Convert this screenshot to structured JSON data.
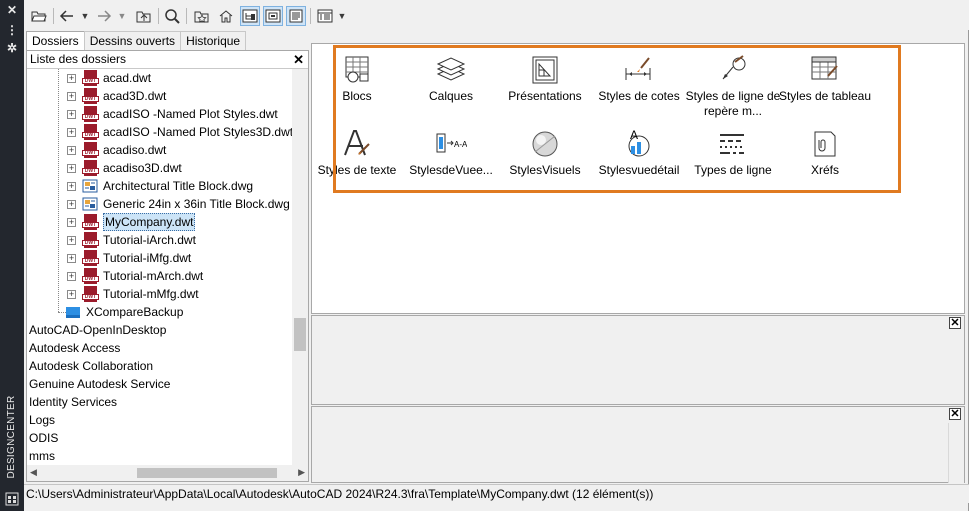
{
  "palette": {
    "title": "DESIGNCENTER",
    "close_glyph": "✕",
    "grip_glyph": "⋮",
    "settings_glyph": "✲"
  },
  "toolbar": {
    "buttons": [
      {
        "name": "open-folder-button",
        "icon": "folder-open-icon"
      },
      {
        "name": "back-button",
        "icon": "back-arrow-icon"
      },
      {
        "name": "back-menu-button",
        "icon": "chevron-down-icon"
      },
      {
        "name": "forward-button",
        "icon": "forward-arrow-icon"
      },
      {
        "name": "forward-menu-button",
        "icon": "chevron-down-icon"
      },
      {
        "name": "up-button",
        "icon": "up-folder-icon"
      },
      {
        "name": "search-button",
        "icon": "search-icon"
      },
      {
        "name": "favorites-button",
        "icon": "star-folder-icon"
      },
      {
        "name": "home-button",
        "icon": "home-icon"
      },
      {
        "name": "tree-toggle-button",
        "icon": "tree-view-icon"
      },
      {
        "name": "preview-button",
        "icon": "preview-icon"
      },
      {
        "name": "description-button",
        "icon": "description-icon"
      },
      {
        "name": "views-button",
        "icon": "views-icon"
      },
      {
        "name": "views-menu-button",
        "icon": "chevron-down-icon"
      }
    ]
  },
  "tabs": [
    "Dossiers",
    "Dessins ouverts",
    "Historique"
  ],
  "tree": {
    "header": "Liste des dossiers",
    "close_glyph": "✕",
    "items": [
      {
        "label": "acad.dwt",
        "kind": "dwt"
      },
      {
        "label": "acad3D.dwt",
        "kind": "dwt"
      },
      {
        "label": "acadISO -Named Plot Styles.dwt",
        "kind": "dwt"
      },
      {
        "label": "acadISO -Named Plot Styles3D.dwt",
        "kind": "dwt"
      },
      {
        "label": "acadiso.dwt",
        "kind": "dwt"
      },
      {
        "label": "acadiso3D.dwt",
        "kind": "dwt"
      },
      {
        "label": "Architectural Title Block.dwg",
        "kind": "dwg"
      },
      {
        "label": "Generic 24in x 36in Title Block.dwg",
        "kind": "dwg"
      },
      {
        "label": "MyCompany.dwt",
        "kind": "dwt",
        "selected": true
      },
      {
        "label": "Tutorial-iArch.dwt",
        "kind": "dwt"
      },
      {
        "label": "Tutorial-iMfg.dwt",
        "kind": "dwt"
      },
      {
        "label": "Tutorial-mArch.dwt",
        "kind": "dwt"
      },
      {
        "label": "Tutorial-mMfg.dwt",
        "kind": "dwt"
      },
      {
        "label": "XCompareBackup",
        "kind": "folder"
      }
    ],
    "folders": [
      "AutoCAD-OpenInDesktop",
      "Autodesk Access",
      "Autodesk Collaboration",
      "Genuine Autodesk Service",
      "Identity Services",
      "Logs",
      "ODIS",
      "mms"
    ],
    "file_badge": "DWT"
  },
  "content": {
    "items": [
      {
        "label": "Blocs",
        "icon": "blocks-icon"
      },
      {
        "label": "Calques",
        "icon": "layers-icon"
      },
      {
        "label": "Présentations",
        "icon": "layouts-icon"
      },
      {
        "label": "Styles de cotes",
        "icon": "dimension-styles-icon"
      },
      {
        "label": "Styles de ligne de repère m...",
        "icon": "multileader-styles-icon"
      },
      {
        "label": "Styles de tableau",
        "icon": "table-styles-icon"
      },
      {
        "label": "Styles de texte",
        "icon": "text-styles-icon"
      },
      {
        "label": "StylesdeVuee...",
        "icon": "view-styles-icon"
      },
      {
        "label": "StylesVisuels",
        "icon": "visual-styles-icon"
      },
      {
        "label": "Stylesvuedétail",
        "icon": "detail-view-styles-icon"
      },
      {
        "label": "Types de ligne",
        "icon": "linetypes-icon"
      },
      {
        "label": "Xréfs",
        "icon": "xrefs-icon"
      }
    ]
  },
  "panes": {
    "close_glyph": "✕"
  },
  "status": "C:\\Users\\Administrateur\\AppData\\Local\\Autodesk\\AutoCAD 2024\\R24.3\\fra\\Template\\MyCompany.dwt (12 élément(s))",
  "colors": {
    "highlight": "#e07a20",
    "dwt_red": "#9b1b2b",
    "selection": "#cce4f7"
  }
}
